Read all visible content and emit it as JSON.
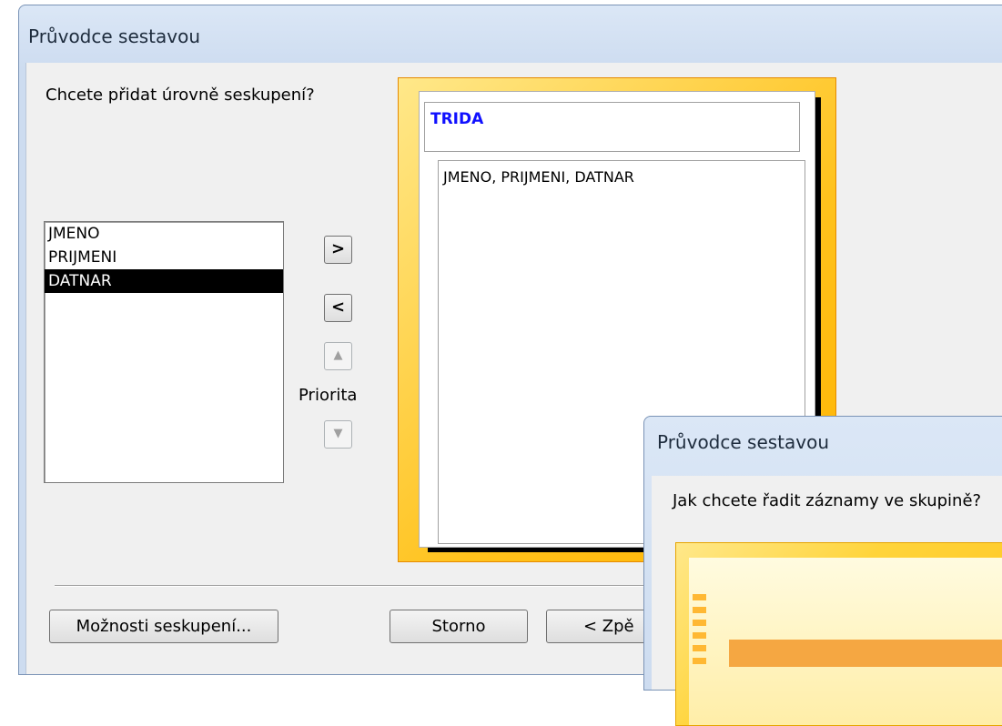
{
  "main_window": {
    "title": "Průvodce sestavou",
    "question": "Chcete přidat úrovně seskupení?",
    "fields": [
      "JMENO",
      "PRIJMENI",
      "DATNAR"
    ],
    "selected_field": "DATNAR",
    "add_button": ">",
    "remove_button": "<",
    "priority_label": "Priorita",
    "preview": {
      "group_header": "TRIDA",
      "detail_fields": "JMENO, PRIJMENI, DATNAR"
    },
    "grouping_options_button": "Možnosti seskupení...",
    "cancel_button": "Storno",
    "back_button": "< Zpě"
  },
  "second_window": {
    "title": "Průvodce sestavou",
    "question": "Jak chcete řadit záznamy ve skupině?"
  }
}
